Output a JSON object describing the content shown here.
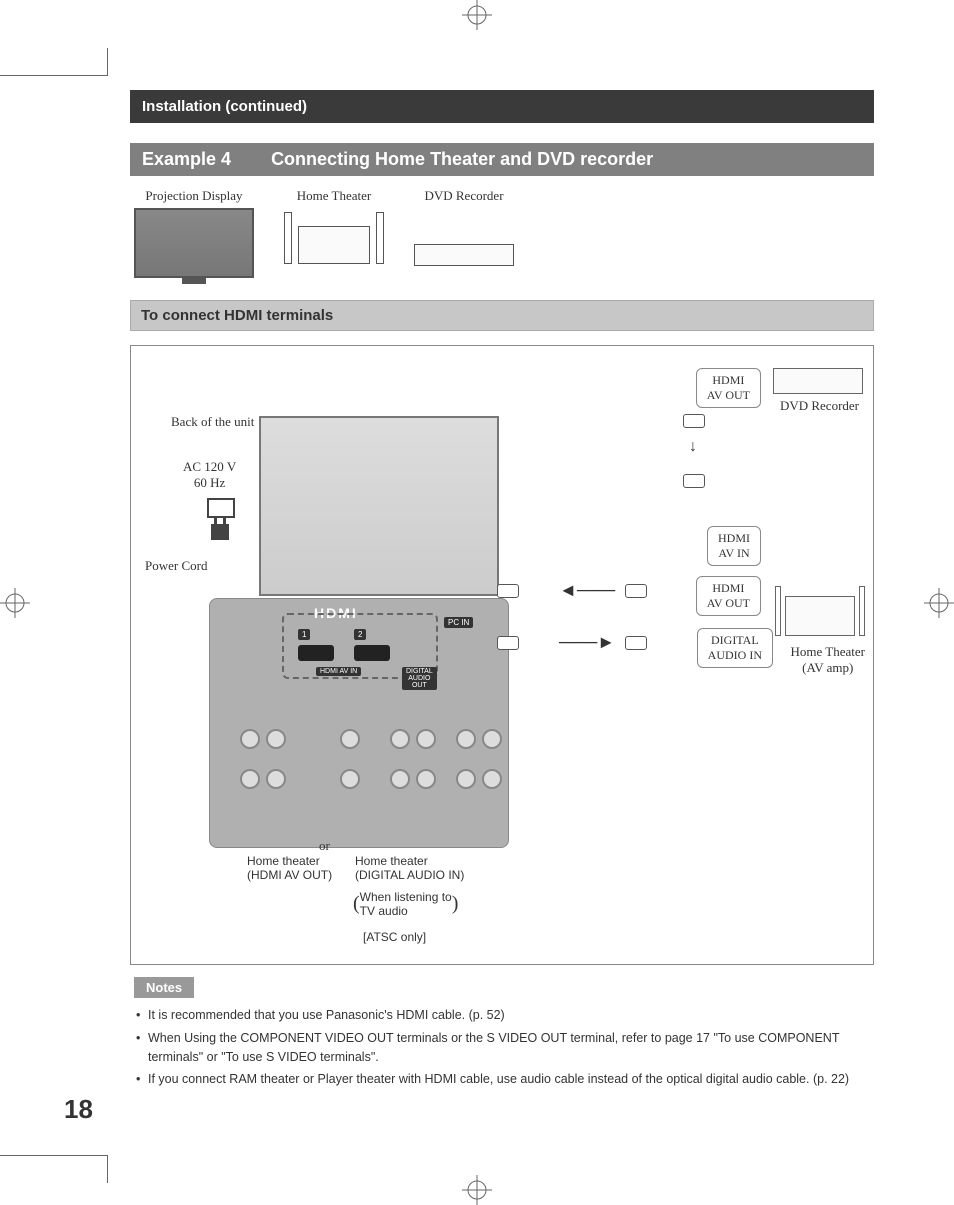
{
  "header": "Installation (continued)",
  "example": {
    "num": "Example 4",
    "title": "Connecting Home Theater and DVD recorder"
  },
  "devices": {
    "projection": "Projection Display",
    "home_theater": "Home Theater",
    "dvd": "DVD Recorder"
  },
  "subheader": "To connect HDMI terminals",
  "diagram": {
    "back_of_unit": "Back of the unit",
    "ac": "AC 120 V\n60 Hz",
    "power_cord": "Power Cord",
    "hdmi_av_out": "HDMI\nAV OUT",
    "hdmi_av_in": "HDMI\nAV IN",
    "digital_audio_in": "DIGITAL\nAUDIO IN",
    "dvd_recorder": "DVD Recorder",
    "home_theater_amp": "Home Theater\n(AV amp)",
    "hdmi_logo": "HDMI",
    "hdmi_av_in_tag": "HDMI  AV IN",
    "digital_audio_out_tag": "DIGITAL\nAUDIO\nOUT",
    "pc_in_tag": "PC IN",
    "num1": "1",
    "num2": "2",
    "or": "or",
    "ht_hdmi": "Home theater\n(HDMI AV OUT)",
    "ht_digital": "Home theater\n(DIGITAL AUDIO IN)",
    "when_listening": "When listening to\nTV audio",
    "atsc": "[ATSC only]"
  },
  "notes_label": "Notes",
  "notes": [
    "It is recommended that you use Panasonic's HDMI cable. (p. 52)",
    "When Using the COMPONENT VIDEO OUT terminals or the S VIDEO OUT terminal, refer to page 17 \"To use COMPONENT terminals\" or \"To use S VIDEO terminals\".",
    "If you connect RAM theater or Player theater with HDMI cable, use audio cable instead of the optical digital audio cable. (p. 22)"
  ],
  "page_number": "18"
}
